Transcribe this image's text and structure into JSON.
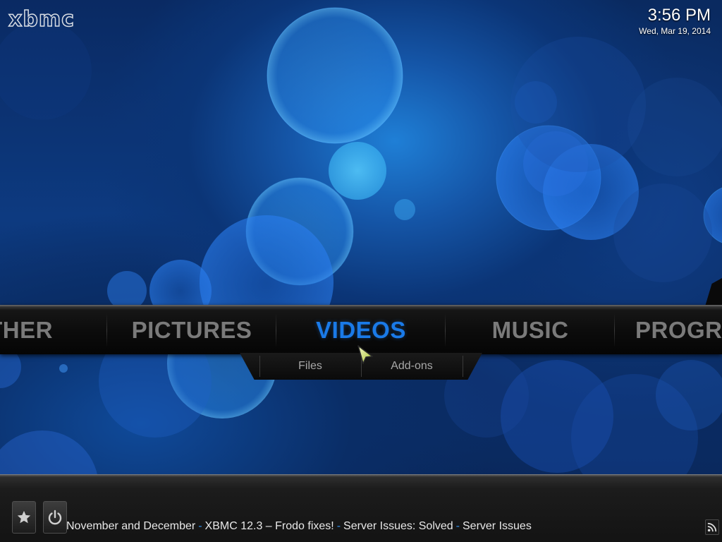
{
  "app": {
    "logo_text": "xbmc"
  },
  "clock": {
    "time": "3:56 PM",
    "date": "Wed, Mar 19, 2014"
  },
  "main_menu": {
    "items": [
      {
        "label": "WEATHER",
        "active": false
      },
      {
        "label": "PICTURES",
        "active": false
      },
      {
        "label": "VIDEOS",
        "active": true
      },
      {
        "label": "MUSIC",
        "active": false
      },
      {
        "label": "PROGRAMS",
        "active": false
      }
    ]
  },
  "submenu": {
    "items": [
      {
        "label": "Files"
      },
      {
        "label": "Add-ons"
      }
    ]
  },
  "footer": {
    "favourites_icon": "star-icon",
    "power_icon": "power-icon",
    "rss_icon": "rss-icon",
    "ticker": [
      "November and December",
      "XBMC 12.3 – Frodo fixes!",
      "Server Issues: Solved",
      "Server Issues"
    ],
    "separator": "-"
  },
  "colors": {
    "accent": "#1a7ae8",
    "menu_inactive": "#7a7a7a",
    "ticker_separator": "#2e8de8"
  }
}
